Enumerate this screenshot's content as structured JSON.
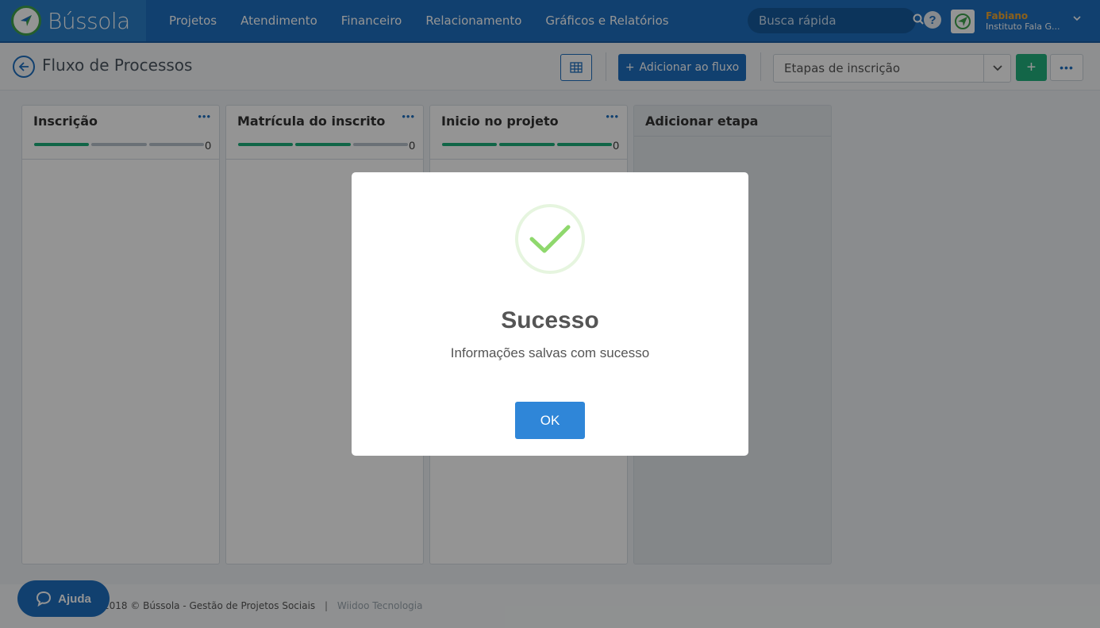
{
  "app": {
    "name": "Bússola"
  },
  "nav": {
    "items": [
      {
        "label": "Projetos"
      },
      {
        "label": "Atendimento"
      },
      {
        "label": "Financeiro"
      },
      {
        "label": "Relacionamento"
      },
      {
        "label": "Gráficos e Relatórios"
      }
    ],
    "search_placeholder": "Busca rápida"
  },
  "user": {
    "name": "Fabiano",
    "org": "Instituto Fala G..."
  },
  "page": {
    "title": "Fluxo de Processos",
    "add_flow_label": "Adicionar ao fluxo",
    "stage_select_value": "Etapas de inscrição"
  },
  "columns": [
    {
      "title": "Inscrição",
      "count": "0",
      "progress": 1,
      "total_segments": 3
    },
    {
      "title": "Matrícula do inscrito",
      "count": "0",
      "progress": 2,
      "total_segments": 3
    },
    {
      "title": "Inicio no projeto",
      "count": "0",
      "progress": 3,
      "total_segments": 3
    }
  ],
  "add_stage": {
    "title": "Adicionar etapa"
  },
  "footer": {
    "copyright": "2018 © Bússola - Gestão de Projetos Sociais",
    "separator": "|",
    "link": "Wiidoo Tecnologia"
  },
  "help_chat": {
    "label": "Ajuda"
  },
  "modal": {
    "title": "Sucesso",
    "message": "Informações salvas com sucesso",
    "ok_label": "OK"
  },
  "colors": {
    "primary": "#1e6fbf",
    "success": "#22b07d",
    "progress_done": "#1cae7a",
    "progress_pending": "#b7c2cb",
    "user_name": "#f0a630",
    "check": "#8fd86d"
  }
}
